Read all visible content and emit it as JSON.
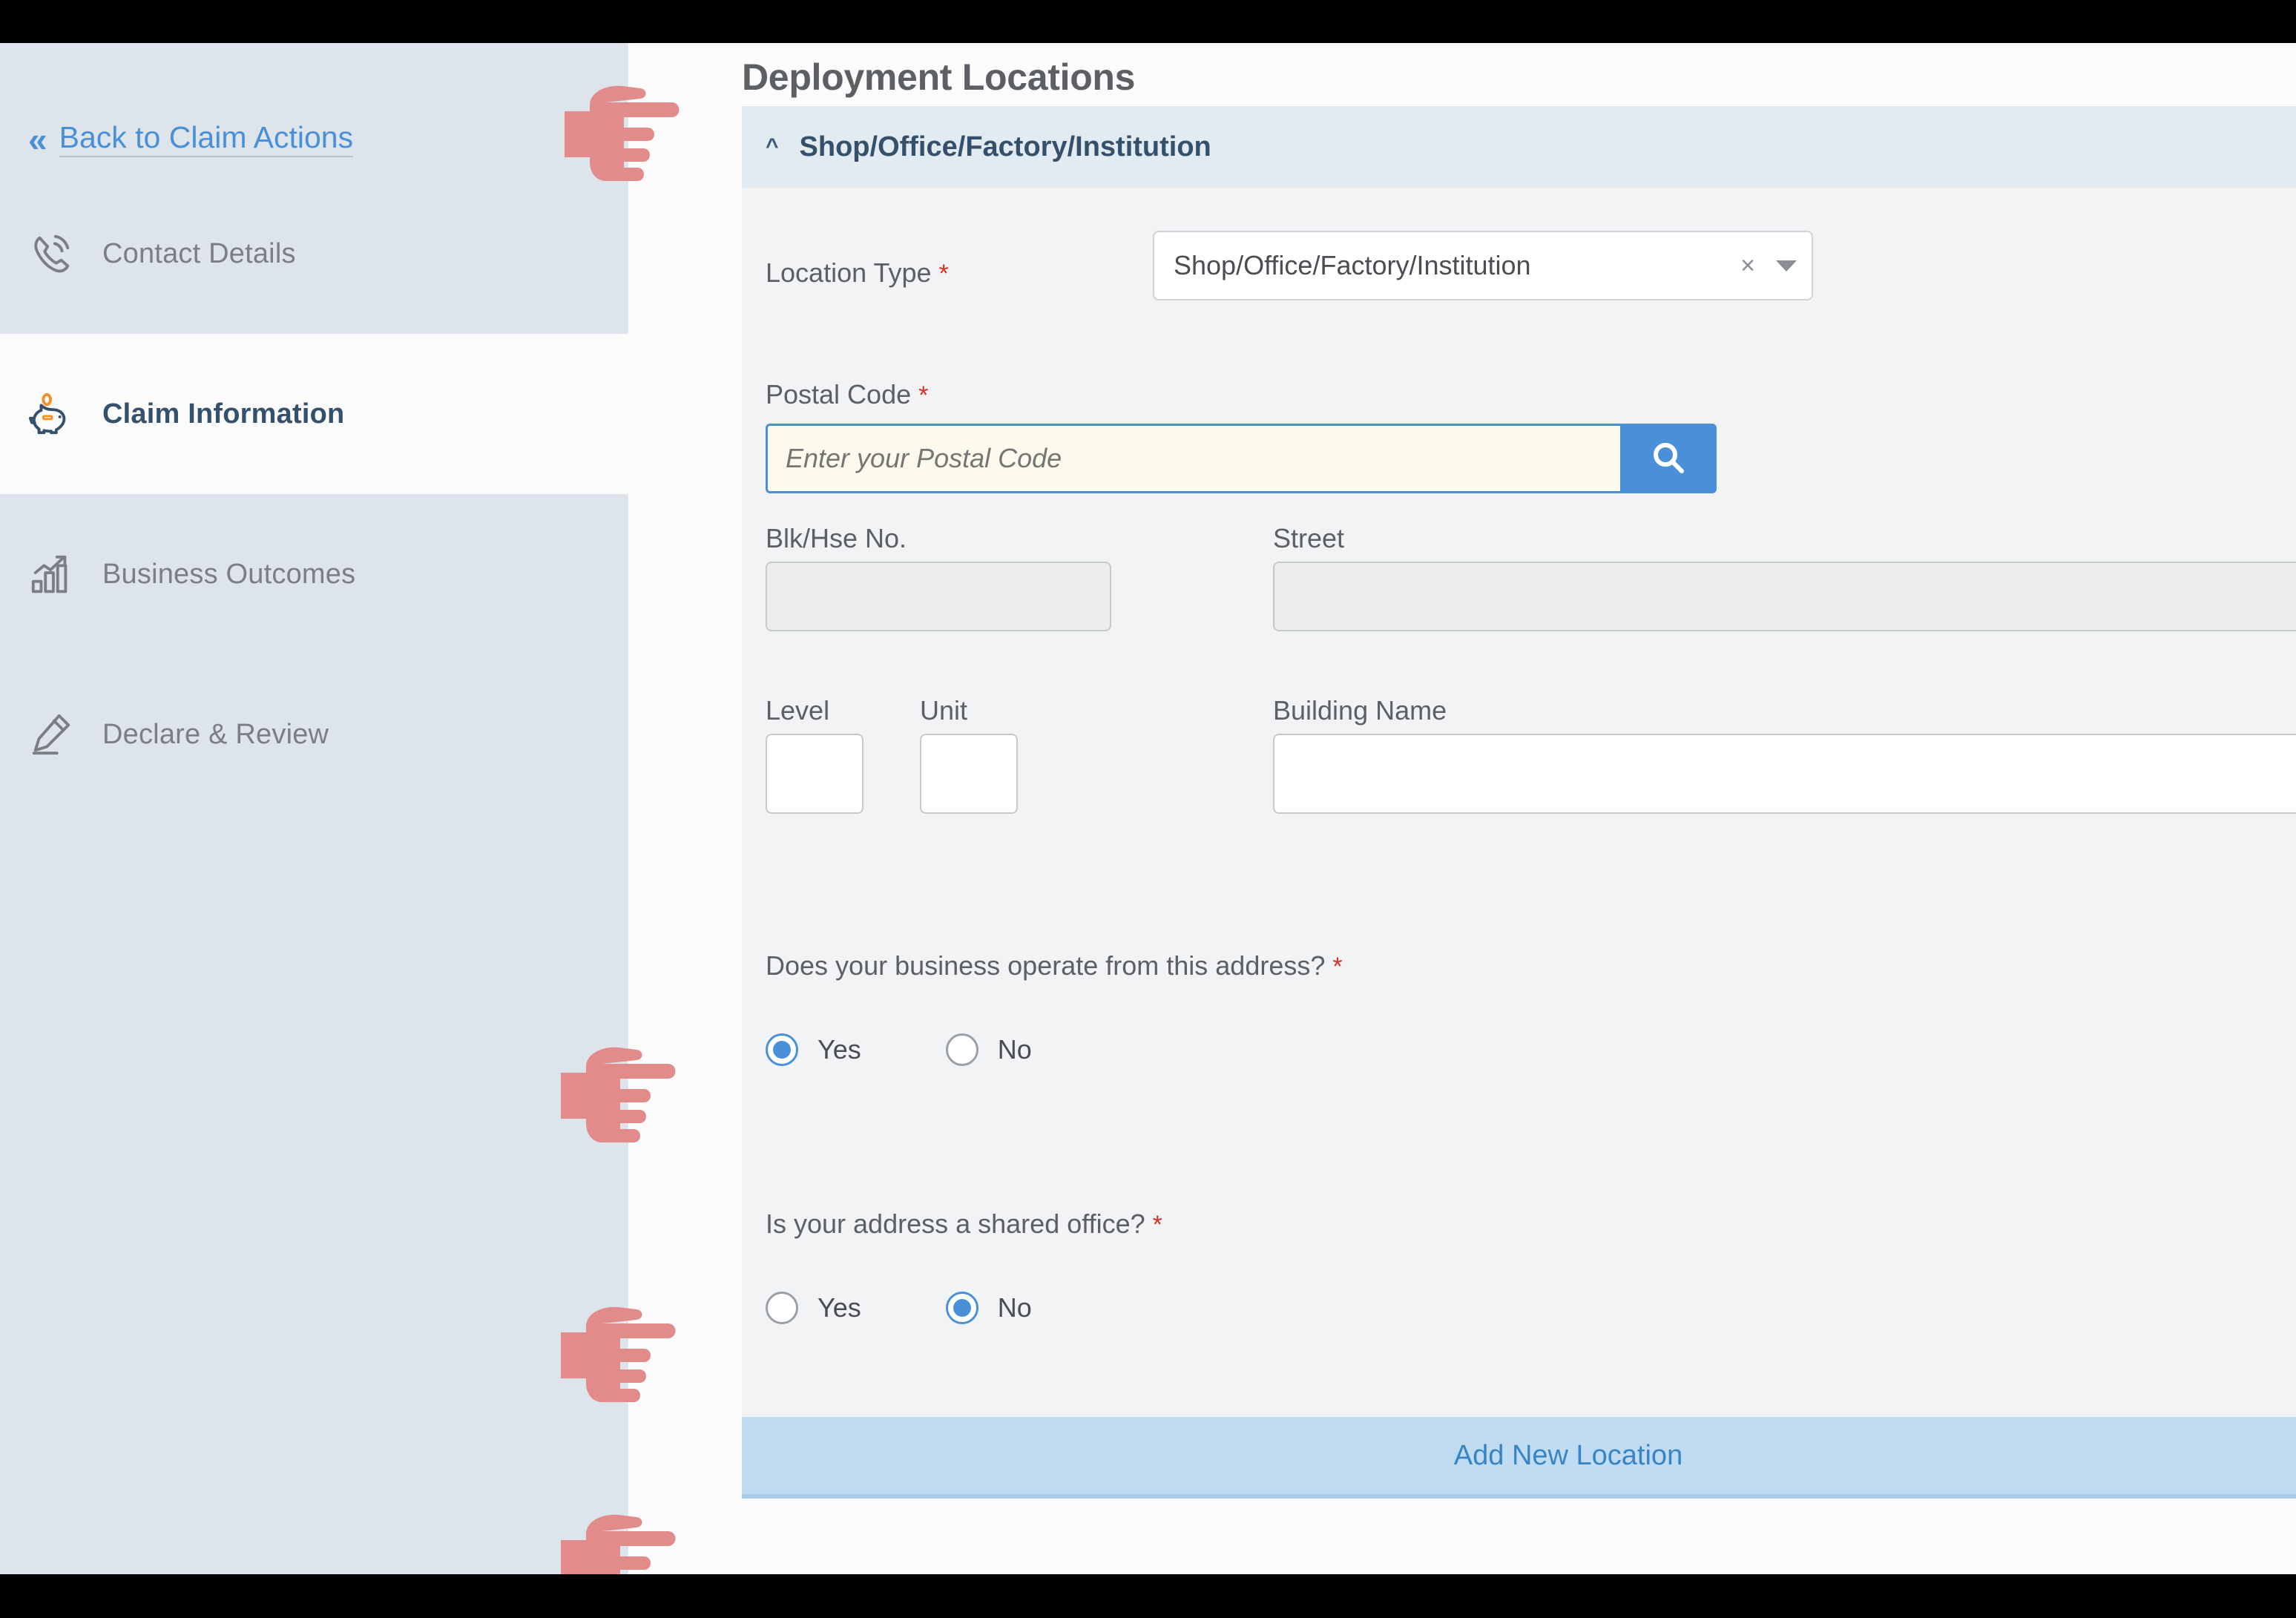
{
  "sidebar": {
    "back_link": {
      "label": "Back to Claim Actions",
      "icon": "double-chevron-left-icon"
    },
    "items": [
      {
        "label": "Contact Details",
        "icon": "phone-icon",
        "active": false
      },
      {
        "label": "Claim Information",
        "icon": "piggy-bank-icon",
        "active": true
      },
      {
        "label": "Business Outcomes",
        "icon": "bar-chart-icon",
        "active": false
      },
      {
        "label": "Declare & Review",
        "icon": "pen-sign-icon",
        "active": false
      }
    ]
  },
  "main": {
    "page_title": "Deployment Locations",
    "accordion": {
      "title": "Shop/Office/Factory/Institution",
      "chevron": "chevron-up-icon",
      "expanded": true
    },
    "fields": {
      "location_type": {
        "label": "Location Type",
        "required_marker": "*",
        "value": "Shop/Office/Factory/Institution",
        "clear_glyph": "×"
      },
      "postal_code": {
        "label": "Postal Code",
        "required_marker": "*",
        "value": "",
        "placeholder": "Enter your Postal Code",
        "search_icon": "magnifier-icon"
      },
      "blk_hse_no": {
        "label": "Blk/Hse No.",
        "value": "",
        "disabled": true
      },
      "street": {
        "label": "Street",
        "value": "",
        "disabled": true
      },
      "level": {
        "label": "Level",
        "value": "",
        "disabled": false
      },
      "unit": {
        "label": "Unit",
        "value": "",
        "disabled": false
      },
      "building_name": {
        "label": "Building Name",
        "value": "",
        "disabled": false
      }
    },
    "questions": [
      {
        "label": "Does your business operate from this address?",
        "required_marker": "*",
        "options": [
          {
            "label": "Yes",
            "selected": true
          },
          {
            "label": "No",
            "selected": false
          }
        ]
      },
      {
        "label": "Is your address a shared office?",
        "required_marker": "*",
        "options": [
          {
            "label": "Yes",
            "selected": false
          },
          {
            "label": "No",
            "selected": true
          }
        ]
      }
    ],
    "add_location_button": {
      "label": "Add New Location"
    }
  },
  "colors": {
    "accent_blue": "#4a90d9",
    "nav_active_text": "#35506b",
    "sidebar_bg": "#dee4ec",
    "accordion_bg": "#e2eaf2",
    "card_bg": "#f2f3f4",
    "footer_btn_bg": "#bfdcf2",
    "required_red": "#d93025",
    "pointer_hand": "#e28b8b"
  },
  "pointer_hands": [
    {
      "target": "back-to-claim-actions"
    },
    {
      "target": "business-operates-question"
    },
    {
      "target": "shared-office-question"
    },
    {
      "target": "add-new-location-button"
    }
  ]
}
